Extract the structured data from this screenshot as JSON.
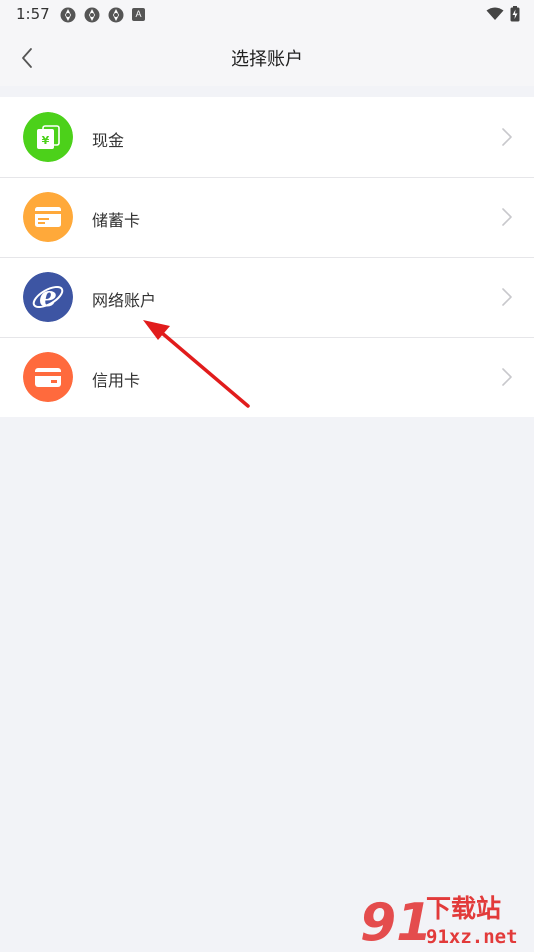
{
  "status_bar": {
    "time": "1:57",
    "notification_badge": "A"
  },
  "header": {
    "title": "选择账户",
    "back_icon": "chevron-left-icon"
  },
  "accounts": [
    {
      "label": "现金",
      "icon": "cash-icon",
      "color": "#4cd11a",
      "glyph": "¥"
    },
    {
      "label": "储蓄卡",
      "icon": "savings-card-icon",
      "color": "#ffa93a"
    },
    {
      "label": "网络账户",
      "icon": "internet-explorer-icon",
      "color": "#3d55a3",
      "glyph": "e"
    },
    {
      "label": "信用卡",
      "icon": "credit-card-icon",
      "color": "#ff6a3d"
    }
  ],
  "watermark": {
    "logo_text": "91",
    "site_text": "下载站",
    "domain_text": "91xz.net"
  }
}
